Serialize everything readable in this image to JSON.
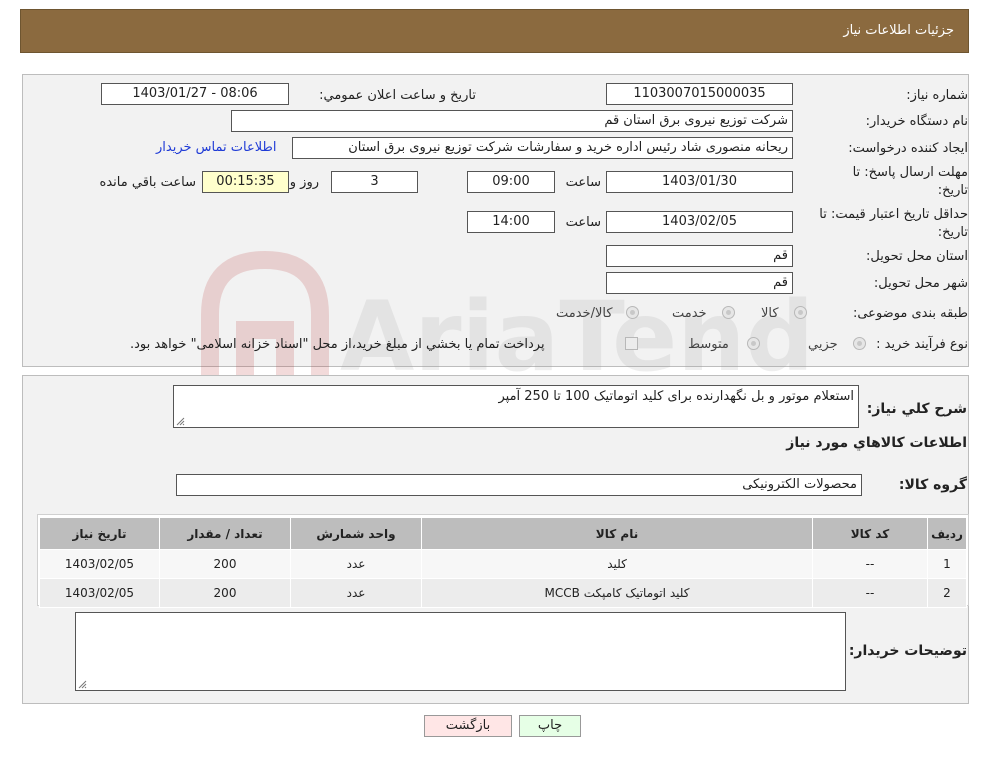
{
  "header": {
    "title": "جزئیات اطلاعات نیاز"
  },
  "need": {
    "number_label": "شماره نیاز:",
    "number_value": "1103007015000035",
    "announce_label": "تاریخ و ساعت اعلان عمومي:",
    "announce_value": "1403/01/27 - 08:06",
    "buyer_label": "نام دستگاه خريدار:",
    "buyer_value": "شرکت توزیع نیروی برق استان قم",
    "creator_label": "ايجاد کننده درخواست:",
    "creator_value": "ریحانه منصوری شاد رئیس اداره خرید و سفارشات شرکت توزیع نیروی برق استان",
    "contact_link": "اطلاعات تماس خريدار",
    "deadline_label_1": "مهلت ارسال پاسخ: تا",
    "deadline_label_2": "تاريخ:",
    "deadline_date": "1403/01/30",
    "hour_label": "ساعت",
    "deadline_time": "09:00",
    "days_value": "3",
    "days_label": "روز و",
    "remaining_value": "00:15:35",
    "remaining_label": "ساعت باقي مانده",
    "validity_label_1": "حداقل تاريخ اعتبار قيمت: تا",
    "validity_label_2": "تاريخ:",
    "validity_date": "1403/02/05",
    "validity_hour_label": "ساعت",
    "validity_time": "14:00",
    "province_label": "استان محل تحويل:",
    "province_value": "قم",
    "city_label": "شهر محل تحويل:",
    "city_value": "قم",
    "category_label": "طبقه بندی موضوعی:",
    "category_options": [
      "کالا",
      "خدمت",
      "کالا/خدمت"
    ],
    "process_label": "نوع فرآيند خريد :",
    "process_options": [
      "جزيي",
      "متوسط"
    ],
    "process_note": "پرداخت تمام يا بخشي از مبلغ خريد،از محل \"اسناد خزانه اسلامی\" خواهد بود."
  },
  "watermark": {
    "text": "AriaTender.neT"
  },
  "details": {
    "description_label": "شرح کلي نياز:",
    "description_value": "استعلام موتور و بل نگهدارنده برای کلید اتوماتیک 100 تا 250 آمپر",
    "goods_heading": "اطلاعات کالاهاي مورد نياز",
    "group_label": "گروه کالا:",
    "group_value": "محصولات الکترونیکی",
    "table": {
      "headers": [
        "رديف",
        "کد کالا",
        "نام کالا",
        "واحد شمارش",
        "تعداد / مقدار",
        "تاريخ نياز"
      ],
      "rows": [
        [
          "1",
          "--",
          "کلید",
          "عدد",
          "200",
          "1403/02/05"
        ],
        [
          "2",
          "--",
          "کلید اتوماتیک کامپکت MCCB",
          "عدد",
          "200",
          "1403/02/05"
        ]
      ]
    },
    "buyer_notes_label": "توضيحات خريدار:",
    "buyer_notes_value": ""
  },
  "buttons": {
    "print": "چاپ",
    "back": "بازگشت"
  },
  "colors": {
    "header_bg": "#8b6a3f",
    "link": "#1f3bd6",
    "print_bg": "#e6ffe6",
    "back_bg": "#ffe6e6",
    "remaining_bg": "#ffffcc"
  }
}
